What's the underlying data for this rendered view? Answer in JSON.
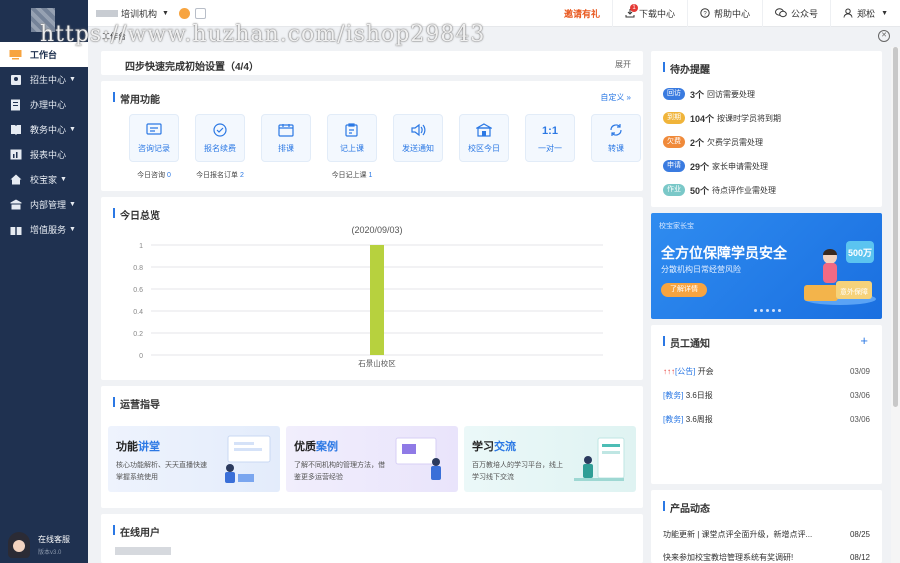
{
  "sidebar": {
    "items": [
      {
        "label": "工作台",
        "icon": "desk-icon",
        "active": true
      },
      {
        "label": "招生中心",
        "icon": "users-icon",
        "caret": "▼"
      },
      {
        "label": "办理中心",
        "icon": "document-icon"
      },
      {
        "label": "教务中心",
        "icon": "book-icon",
        "caret": "▼"
      },
      {
        "label": "报表中心",
        "icon": "report-icon"
      },
      {
        "label": "校宝家",
        "icon": "home-icon",
        "caret": "▼"
      },
      {
        "label": "内部管理",
        "icon": "building-icon",
        "caret": "▼"
      },
      {
        "label": "增值服务",
        "icon": "gift-icon",
        "caret": "▼"
      }
    ],
    "support_label": "在线客服",
    "version": "版本v3.0"
  },
  "topbar": {
    "org_name": "培训机构",
    "promo_label": "邀请有礼",
    "download_label": "下载中心",
    "download_badge": "1",
    "help_label": "帮助中心",
    "wechat_label": "公众号",
    "user_name": "郑松"
  },
  "tabs": {
    "current": "工作台"
  },
  "watermark": "https://www.huzhan.com/ishop29843",
  "setup": {
    "title": "四步快速完成初始设置（4/4）",
    "action": "展开"
  },
  "functions": {
    "title": "常用功能",
    "customize": "自定义 »",
    "items": [
      {
        "label": "咨询记录",
        "icon": "chat-record-icon",
        "stat_label": "今日咨询",
        "stat_value": "0"
      },
      {
        "label": "报名续费",
        "icon": "enroll-icon",
        "stat_label": "今日报名订单",
        "stat_value": "2"
      },
      {
        "label": "排课",
        "icon": "calendar-icon",
        "stat_label": "",
        "stat_value": ""
      },
      {
        "label": "记上课",
        "icon": "clipboard-icon",
        "stat_label": "今日记上课",
        "stat_value": "1"
      },
      {
        "label": "发送通知",
        "icon": "speaker-icon",
        "stat_label": "",
        "stat_value": ""
      },
      {
        "label": "校区今日",
        "icon": "campus-icon",
        "stat_label": "",
        "stat_value": ""
      },
      {
        "label": "一对一",
        "icon": "one-on-one-icon",
        "stat_label": "",
        "stat_value": ""
      },
      {
        "label": "转课",
        "icon": "transfer-icon",
        "stat_label": "",
        "stat_value": ""
      }
    ]
  },
  "today": {
    "title": "今日总览"
  },
  "chart_data": {
    "type": "bar",
    "title": "(2020/09/03)",
    "categories": [
      "石景山校区"
    ],
    "values": [
      1
    ],
    "ylim": [
      0,
      1
    ],
    "yticks": [
      "0",
      "0.2",
      "0.4",
      "0.6",
      "0.8",
      "1"
    ],
    "bar_color": "#b7d13e",
    "grid": true
  },
  "guide": {
    "title": "运营指导",
    "cards": [
      {
        "title_a": "功能",
        "title_b": "讲堂",
        "desc": "核心功能解析、天天直播快速掌握系统使用"
      },
      {
        "title_a": "优质",
        "title_b": "案例",
        "desc": "了解不同机构的管理方法，借鉴更多运营经验"
      },
      {
        "title_a": "学习",
        "title_b": "交流",
        "desc": "百万教培人的学习平台，线上学习线下交流"
      }
    ]
  },
  "online": {
    "title": "在线用户"
  },
  "todo": {
    "title": "待办提醒",
    "items": [
      {
        "tag": "回访",
        "color": "#3a7be0",
        "count": "3个",
        "text": "回访需要处理"
      },
      {
        "tag": "到期",
        "color": "#f0b43a",
        "count": "104个",
        "text": "按课时学员将到期"
      },
      {
        "tag": "欠费",
        "color": "#f08a3a",
        "count": "2个",
        "text": "欠费学员需处理"
      },
      {
        "tag": "申请",
        "color": "#3a7be0",
        "count": "29个",
        "text": "家长申请需处理"
      },
      {
        "tag": "作业",
        "color": "#7ac8c8",
        "count": "50个",
        "text": "待点评作业需处理"
      }
    ]
  },
  "banner": {
    "logo": "校宝家长宝",
    "title": "全方位保障学员安全",
    "subtitle": "分散机构日常经营风险",
    "button": "了解详情",
    "badge": "500万",
    "badge2": "意外保障"
  },
  "notice": {
    "title": "员工通知",
    "items": [
      {
        "hot": "↑↑↑",
        "tag": "[公告]",
        "text": "开会",
        "date": "03/09"
      },
      {
        "hot": "",
        "tag": "[教务]",
        "text": "3.6日报",
        "date": "03/06"
      },
      {
        "hot": "",
        "tag": "[教务]",
        "text": "3.6周报",
        "date": "03/06"
      }
    ]
  },
  "product": {
    "title": "产品动态",
    "items": [
      {
        "text": "功能更新 | 课堂点评全面升级，新增点评...",
        "date": "08/25"
      },
      {
        "text": "快来参加校宝教培管理系统有奖调研!",
        "date": "08/12"
      }
    ]
  }
}
